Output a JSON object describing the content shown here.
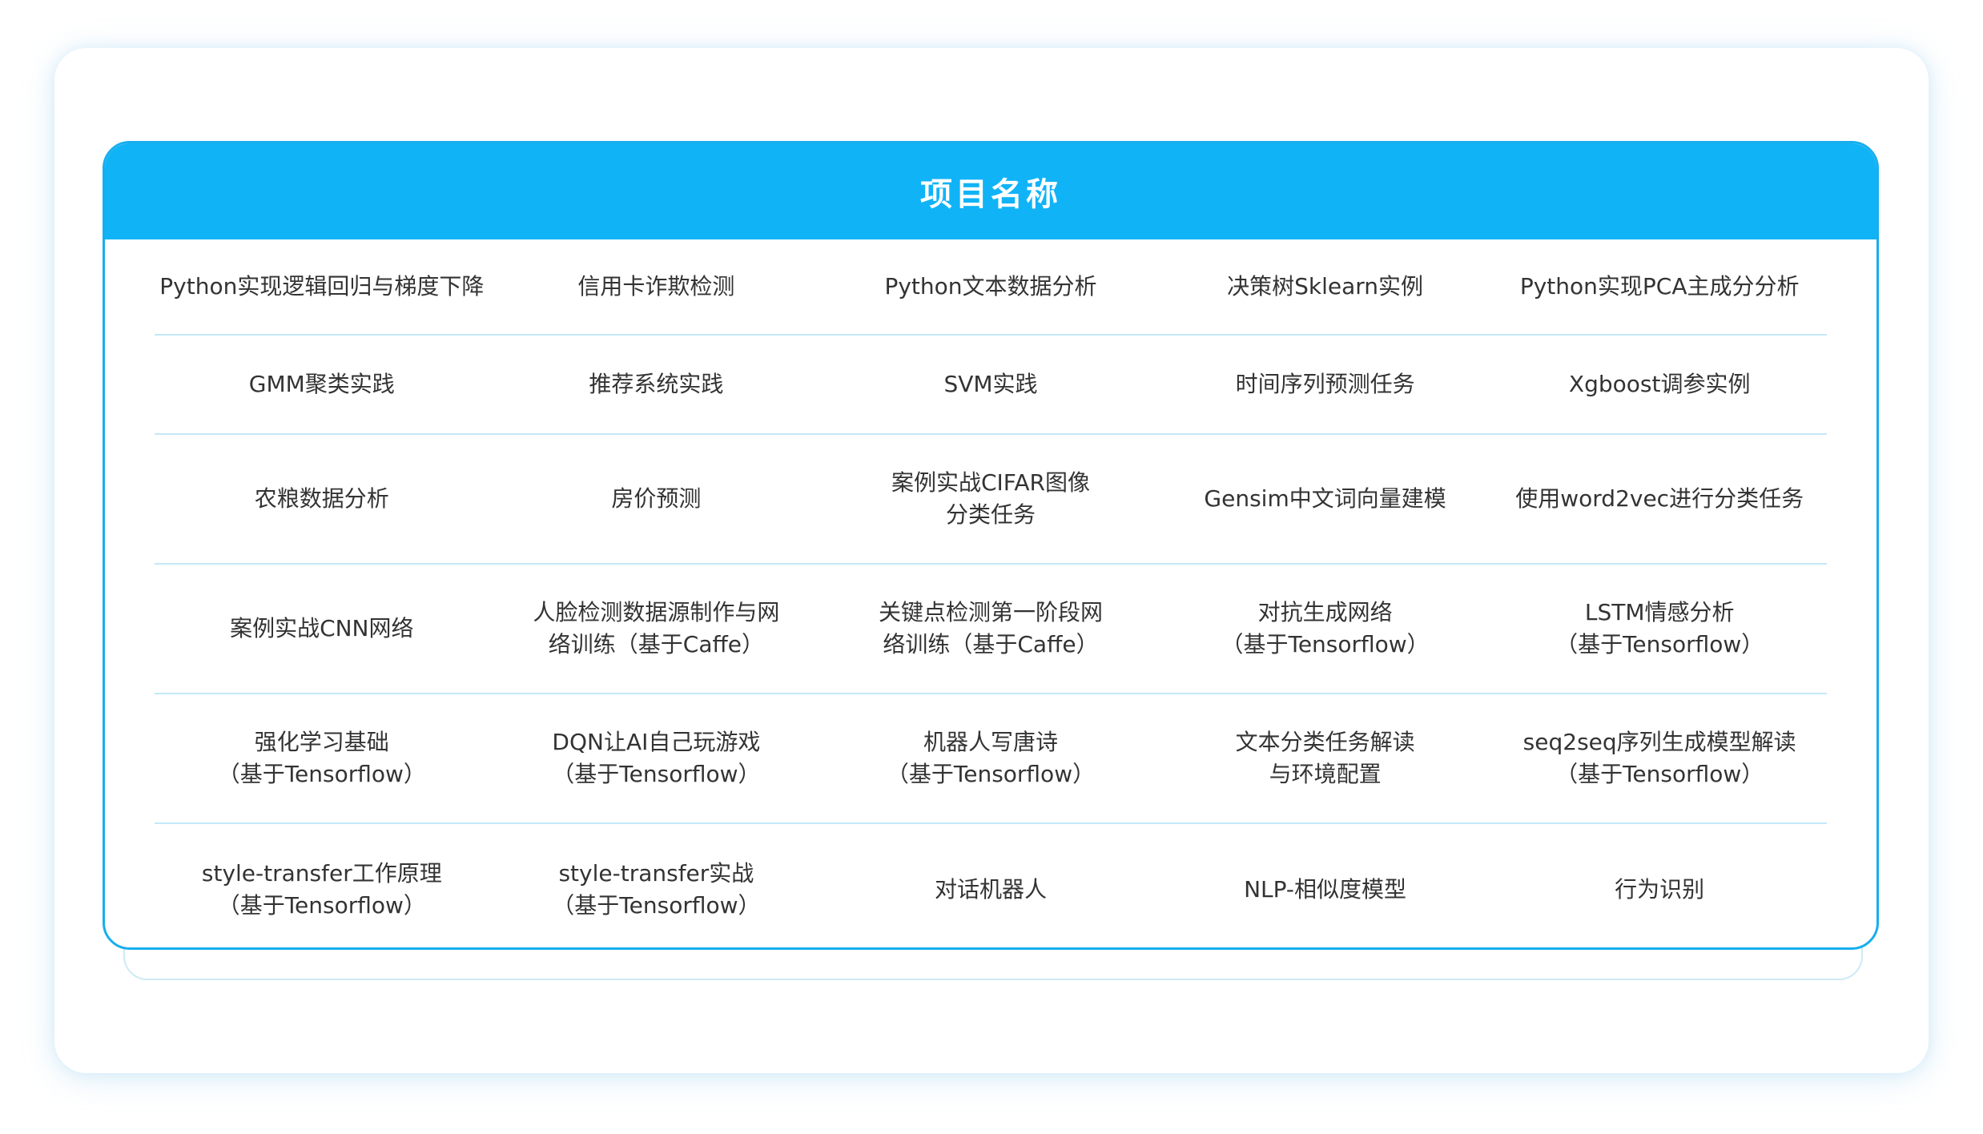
{
  "table": {
    "title": "项目名称",
    "rows": [
      [
        "Python实现逻辑回归与梯度下降",
        "信用卡诈欺检测",
        "Python文本数据分析",
        "决策树Sklearn实例",
        "Python实现PCA主成分分析"
      ],
      [
        "GMM聚类实践",
        "推荐系统实践",
        "SVM实践",
        "时间序列预测任务",
        "Xgboost调参实例"
      ],
      [
        "农粮数据分析",
        "房价预测",
        "案例实战CIFAR图像\n分类任务",
        "Gensim中文词向量建模",
        "使用word2vec进行分类任务"
      ],
      [
        "案例实战CNN网络",
        "人脸检测数据源制作与网\n络训练（基于Caffe）",
        "关键点检测第一阶段网\n络训练（基于Caffe）",
        "对抗生成网络\n（基于Tensorflow）",
        "LSTM情感分析\n（基于Tensorflow）"
      ],
      [
        "强化学习基础\n（基于Tensorflow）",
        "DQN让AI自己玩游戏\n（基于Tensorflow）",
        "机器人写唐诗\n（基于Tensorflow）",
        "文本分类任务解读\n与环境配置",
        "seq2seq序列生成模型解读\n（基于Tensorflow）"
      ],
      [
        "style-transfer工作原理\n（基于Tensorflow）",
        "style-transfer实战\n（基于Tensorflow）",
        "对话机器人",
        "NLP-相似度模型",
        "行为识别"
      ]
    ]
  },
  "colors": {
    "header": "#11b3f7",
    "border": "#17aeee",
    "divider": "#c4e8f7",
    "text": "#333333"
  }
}
